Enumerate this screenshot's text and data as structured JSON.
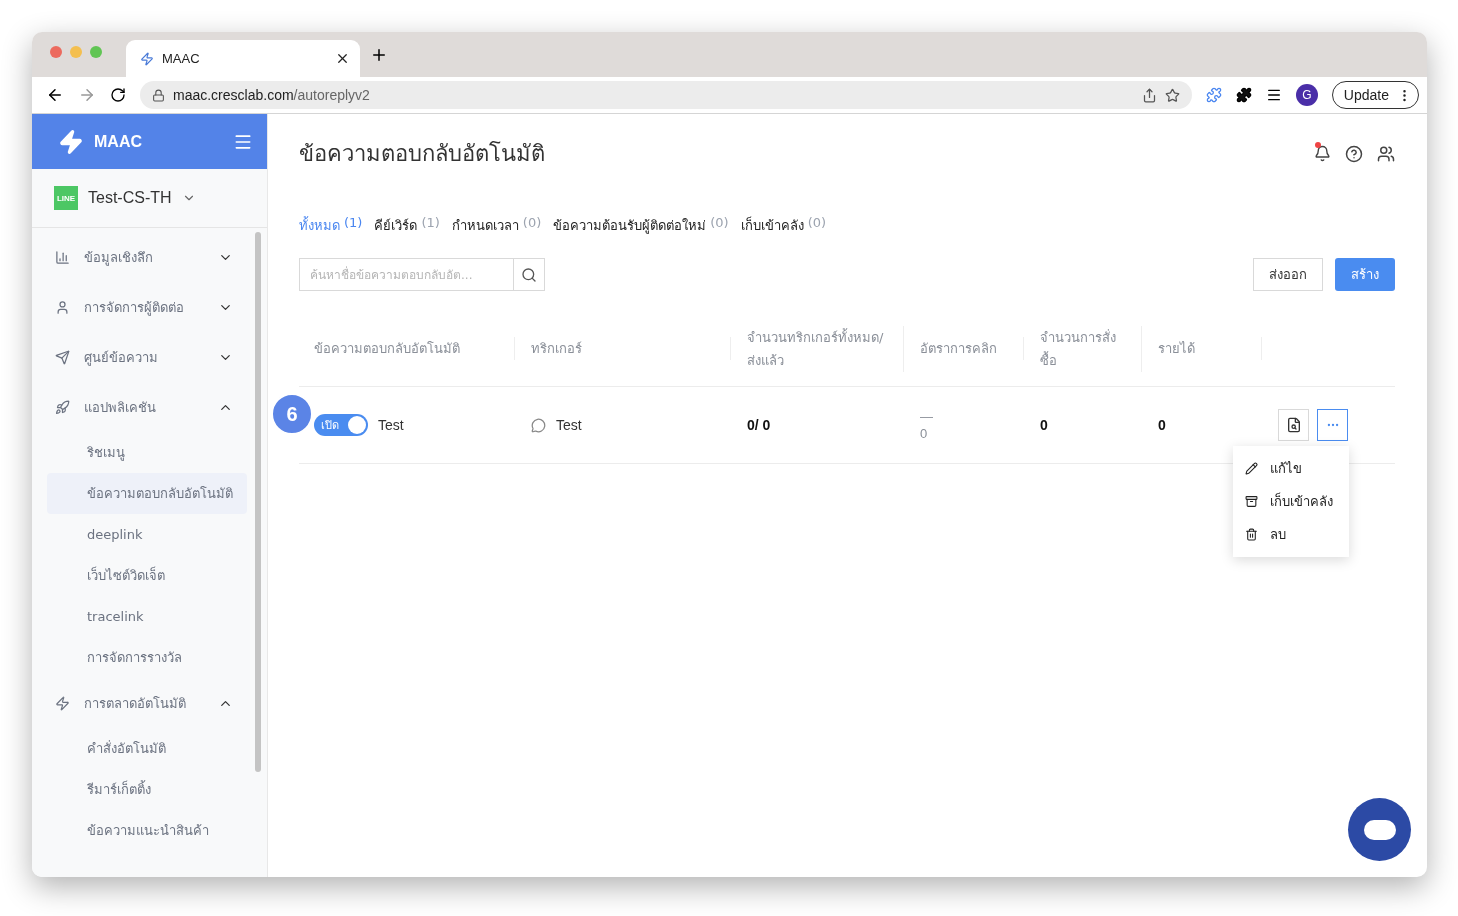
{
  "browser": {
    "tab_title": "MAAC",
    "url_host": "maac.cresclab.com",
    "url_path": "/autoreplyv2",
    "profile_initial": "G",
    "update_button": "Update"
  },
  "sidebar": {
    "brand": "MAAC",
    "account": {
      "badge": "LINE",
      "name": "Test-CS-TH"
    },
    "items": [
      {
        "label": "ข้อมูลเชิงลึก",
        "expanded": false
      },
      {
        "label": "การจัดการผู้ติดต่อ",
        "expanded": false
      },
      {
        "label": "ศูนย์ข้อความ",
        "expanded": false
      },
      {
        "label": "แอปพลิเคชัน",
        "expanded": true,
        "children": [
          {
            "label": "ริชเมนู",
            "selected": false
          },
          {
            "label": "ข้อความตอบกลับอัตโนมัติ",
            "selected": true
          },
          {
            "label": "deeplink",
            "selected": false
          },
          {
            "label": "เว็บไซต์วิดเจ็ต",
            "selected": false
          },
          {
            "label": "tracelink",
            "selected": false
          },
          {
            "label": "การจัดการรางวัล",
            "selected": false
          }
        ]
      },
      {
        "label": "การตลาดอัตโนมัติ",
        "expanded": true,
        "children": [
          {
            "label": "คำสั่งอัตโนมัติ",
            "selected": false
          },
          {
            "label": "รีมาร์เก็ตติ้ง",
            "selected": false
          },
          {
            "label": "ข้อความแนะนำสินค้า",
            "selected": false
          }
        ]
      }
    ]
  },
  "main": {
    "title": "ข้อความตอบกลับอัตโนมัติ",
    "tabs": [
      {
        "label": "ทั้งหมด",
        "count": "(1)",
        "selected": true
      },
      {
        "label": "คีย์เวิร์ด",
        "count": "(1)",
        "selected": false
      },
      {
        "label": "กำหนดเวลา",
        "count": "(0)",
        "selected": false
      },
      {
        "label": "ข้อความต้อนรับผู้ติดต่อใหม่",
        "count": "(0)",
        "selected": false
      },
      {
        "label": "เก็บเข้าคลัง",
        "count": "(0)",
        "selected": false
      }
    ],
    "search": {
      "placeholder": "ค้นหาชื่อข้อความตอบกลับอัต..."
    },
    "export_button": "ส่งออก",
    "create_button": "สร้าง",
    "table": {
      "columns": [
        "ข้อความตอบกลับอัตโนมัติ",
        "ทริกเกอร์",
        "จำนวนทริกเกอร์ทั้งหมด/ส่งแล้ว",
        "อัตราการคลิก",
        "จำนวนการสั่งซื้อ",
        "รายได้"
      ],
      "rows": [
        {
          "enabled": true,
          "toggle_label": "เปิด",
          "name": "Test",
          "trigger": "Test",
          "triggers_sent": "0/ 0",
          "click_rate_dash": "—",
          "click_rate": "0",
          "orders": "0",
          "revenue": "0"
        }
      ]
    },
    "row_menu": [
      "แก้ไข",
      "เก็บเข้าคลัง",
      "ลบ"
    ],
    "step_badge": "6"
  }
}
